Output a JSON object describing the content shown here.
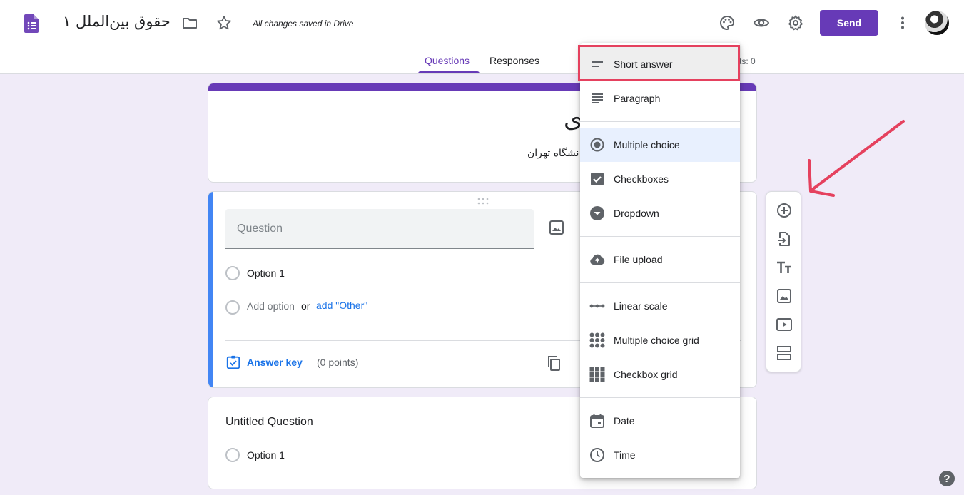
{
  "header": {
    "title": "حقوق بین‌الملل ۱",
    "saved_status": "All changes saved in Drive",
    "send_label": "Send",
    "icons": [
      "forms-logo-icon",
      "folder-icon",
      "star-icon",
      "palette-icon",
      "eye-icon",
      "gear-icon",
      "more-vert-icon"
    ]
  },
  "tabs": {
    "questions": "Questions",
    "responses": "Responses",
    "points_total": "ts: 0"
  },
  "form": {
    "title": "ی",
    "description": "نشگاه تهران"
  },
  "question1": {
    "placeholder": "Question",
    "option1": "Option 1",
    "add_option": "Add option",
    "or": "or",
    "add_other": "add \"Other\"",
    "answer_key": "Answer key",
    "points": "(0 points)"
  },
  "question2": {
    "title": "Untitled Question",
    "option1": "Option 1"
  },
  "menu": {
    "items": [
      {
        "label": "Short answer",
        "icon": "short-text-icon"
      },
      {
        "label": "Paragraph",
        "icon": "paragraph-icon"
      },
      {
        "label": "Multiple choice",
        "icon": "radio-button-icon"
      },
      {
        "label": "Checkboxes",
        "icon": "checkbox-icon"
      },
      {
        "label": "Dropdown",
        "icon": "dropdown-icon"
      },
      {
        "label": "File upload",
        "icon": "cloud-upload-icon"
      },
      {
        "label": "Linear scale",
        "icon": "linear-scale-icon"
      },
      {
        "label": "Multiple choice grid",
        "icon": "grid-dots-icon"
      },
      {
        "label": "Checkbox grid",
        "icon": "grid-squares-icon"
      },
      {
        "label": "Date",
        "icon": "calendar-icon"
      },
      {
        "label": "Time",
        "icon": "clock-icon"
      }
    ],
    "selected": "Multiple choice",
    "hovered": "Short answer"
  },
  "help_label": "?",
  "colors": {
    "accent": "#673ab7",
    "background": "#f0ebf8",
    "active_question": "#4285f4",
    "link": "#1a73e8",
    "annotation": "#e5415e"
  }
}
